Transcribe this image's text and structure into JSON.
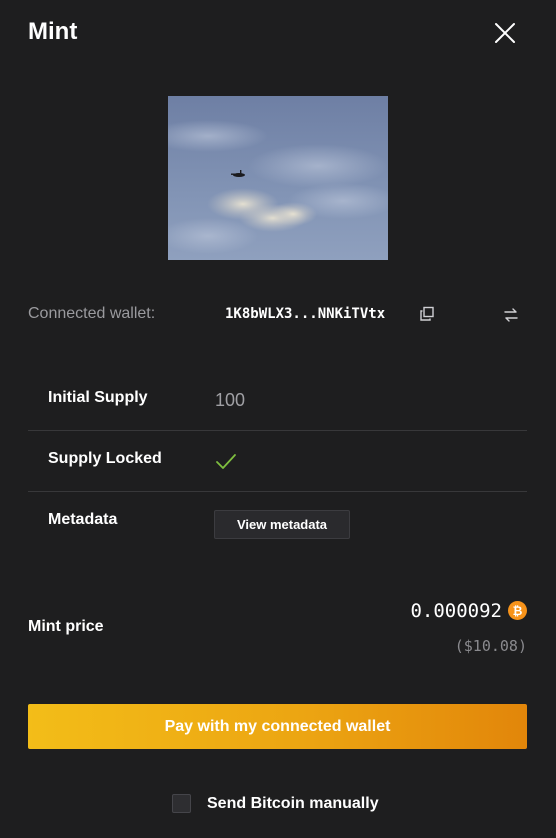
{
  "modal": {
    "title": "Mint",
    "close_icon": "close-icon"
  },
  "preview": {
    "icon": "sky-photo-with-aircraft"
  },
  "wallet": {
    "label": "Connected wallet:",
    "address": "1K8bWLX3...NNKiTVtx",
    "copy_icon": "copy-icon",
    "switch_icon": "swap-arrows-icon"
  },
  "details": {
    "initial_supply_label": "Initial Supply",
    "initial_supply_value": "100",
    "supply_locked_label": "Supply Locked",
    "supply_locked_value": true,
    "supply_locked_icon": "checkmark-icon",
    "metadata_label": "Metadata",
    "metadata_button": "View metadata"
  },
  "price": {
    "label": "Mint price",
    "btc_value": "0.000092",
    "currency_icon": "bitcoin-icon",
    "usd_value": "($10.08)"
  },
  "actions": {
    "pay_button": "Pay with my connected wallet",
    "manual_checkbox_checked": false,
    "manual_label": "Send Bitcoin manually"
  },
  "colors": {
    "background": "#1e1e1f",
    "accent_start": "#f3bd18",
    "accent_end": "#e2860a",
    "check_green": "#7fbf3f",
    "bitcoin_orange": "#f7931a"
  }
}
